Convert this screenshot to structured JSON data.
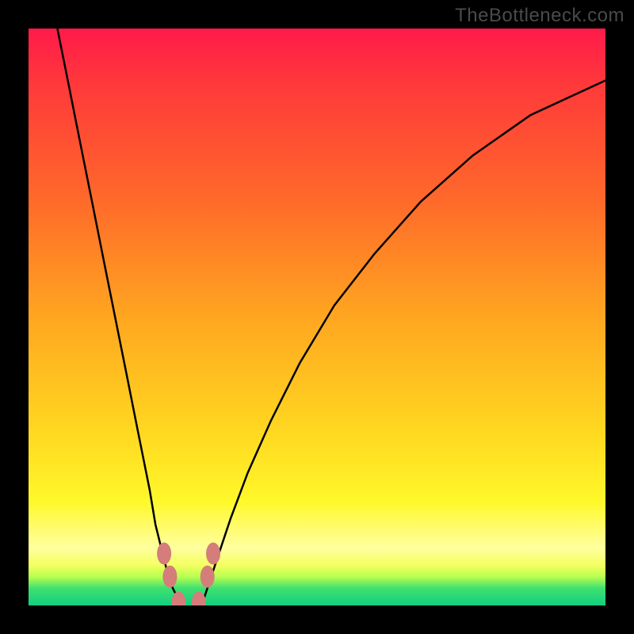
{
  "watermark": "TheBottleneck.com",
  "colors": {
    "frame_bg_top": "#ff1a4a",
    "frame_bg_bottom": "#10d080",
    "curve": "#000000",
    "bead": "#d47d7a",
    "page_bg": "#000000"
  },
  "chart_data": {
    "type": "line",
    "title": "",
    "xlabel": "",
    "ylabel": "",
    "xlim": [
      0,
      100
    ],
    "ylim": [
      0,
      100
    ],
    "series": [
      {
        "name": "left-curve",
        "x": [
          5,
          7,
          9,
          11,
          13,
          15,
          17,
          19,
          21,
          22,
          23,
          24,
          25,
          26,
          26.5
        ],
        "y": [
          100,
          90,
          80,
          70,
          60,
          50,
          40,
          30,
          20,
          14,
          10,
          6,
          3,
          1,
          0
        ]
      },
      {
        "name": "right-curve",
        "x": [
          30,
          31,
          33,
          35,
          38,
          42,
          47,
          53,
          60,
          68,
          77,
          87,
          100
        ],
        "y": [
          0,
          3,
          9,
          15,
          23,
          32,
          42,
          52,
          61,
          70,
          78,
          85,
          91
        ]
      }
    ],
    "annotations": [
      {
        "name": "bead-left-upper",
        "x": 23.5,
        "y": 9
      },
      {
        "name": "bead-left-lower",
        "x": 24.5,
        "y": 5
      },
      {
        "name": "bead-bottom-left",
        "x": 26.0,
        "y": 0.5
      },
      {
        "name": "bead-bottom-right",
        "x": 29.5,
        "y": 0.5
      },
      {
        "name": "bead-right-lower",
        "x": 31.0,
        "y": 5
      },
      {
        "name": "bead-right-upper",
        "x": 32.0,
        "y": 9
      }
    ]
  }
}
